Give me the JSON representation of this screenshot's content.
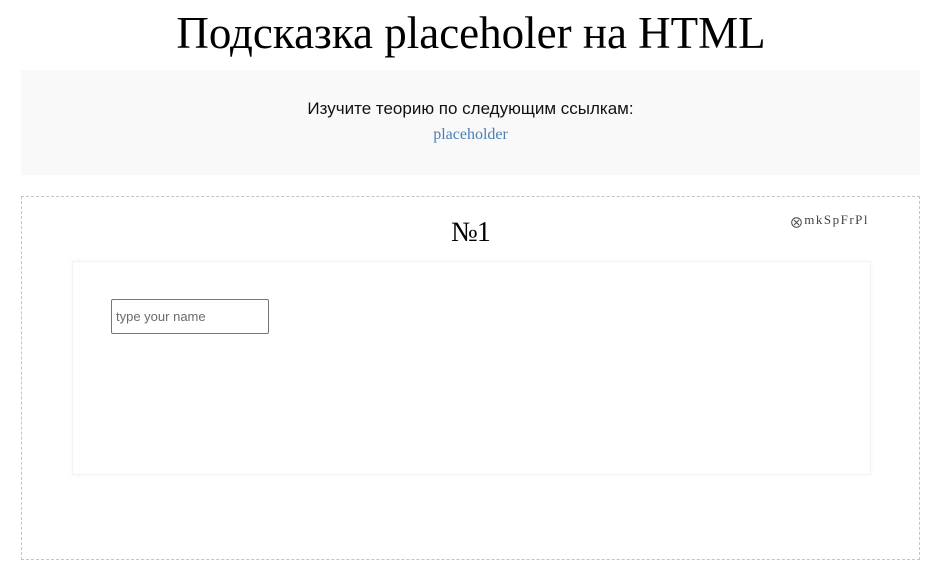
{
  "page": {
    "title": "Подсказка placeholer на HTML"
  },
  "theory": {
    "text": "Изучите теорию по следующим ссылкам:",
    "link_label": "placeholder"
  },
  "task": {
    "number": "№1",
    "code": "mkSpFrPl",
    "code_icon": "circle-x-icon",
    "input": {
      "value": "",
      "placeholder": "type your name"
    }
  },
  "colors": {
    "link": "#4a7fb5",
    "theory_background": "#f9f9f9",
    "task_border": "#c4c4c4"
  }
}
